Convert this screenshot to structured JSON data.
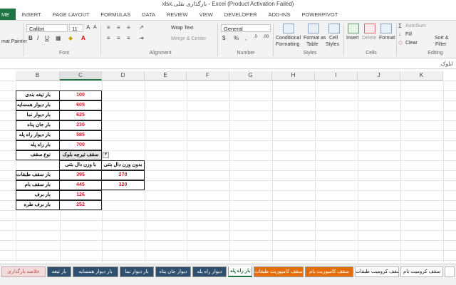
{
  "window": {
    "title": "xlsx.بارگذاری نقلی - Excel (Product Activation Failed)"
  },
  "ribbon_tabs": [
    "ME",
    "INSERT",
    "PAGE LAYOUT",
    "FORMULAS",
    "DATA",
    "REVIEW",
    "VIEW",
    "DEVELOPER",
    "ADD-INS",
    "POWERPIVOT"
  ],
  "ribbon": {
    "clipboard": {
      "format_painter": "mat Painter",
      "label": ""
    },
    "font": {
      "name": "Calibri",
      "size": "11",
      "label": "Font"
    },
    "alignment": {
      "wrap_text": "Wrap Text",
      "merge_center": "Merge & Center",
      "label": "Alignment"
    },
    "number": {
      "format": "General",
      "label": "Number"
    },
    "styles": {
      "conditional": "Conditional",
      "formatting": "Formatting",
      "format_as": "Format as",
      "table": "Table",
      "cell": "Cell",
      "styles_word": "Styles",
      "label": "Styles"
    },
    "cells": {
      "insert": "Insert",
      "delete": "Delete",
      "format": "Format",
      "label": "Cells"
    },
    "editing": {
      "autosum": "AutoSum",
      "fill": "Fill",
      "clear": "Clear",
      "sort": "Sort &",
      "filter": "Filter",
      "label": "Editing"
    }
  },
  "formula_bar": {
    "content": "ابلوک"
  },
  "columns": [
    "B",
    "C",
    "D",
    "E",
    "F",
    "G",
    "H",
    "I",
    "J",
    "K"
  ],
  "table1": [
    {
      "label": "بار تیغه بندی",
      "value": "100"
    },
    {
      "label": "بار دیوار همسایه",
      "value": "605"
    },
    {
      "label": "بار دیوار نما",
      "value": "625"
    },
    {
      "label": "بار جان پناه",
      "value": "230"
    },
    {
      "label": "بار دیوار راه پله",
      "value": "585"
    },
    {
      "label": "بار راه پله",
      "value": "700"
    }
  ],
  "roof": {
    "label": "نوع سقف",
    "selected": "سقف تیرچه بلوک"
  },
  "load_table": {
    "col_with": "با وزن دال بتنی",
    "col_without": "بدون وزن دال بتنی",
    "rows": [
      {
        "label": "بار سقف طبقات",
        "with": "395",
        "without": "270"
      },
      {
        "label": "بار سقف بام",
        "with": "445",
        "without": "320"
      },
      {
        "label": "بار برف",
        "with": "126",
        "without": ""
      },
      {
        "label": "بار برف طره",
        "with": "252",
        "without": ""
      }
    ]
  },
  "sheet_tabs": [
    {
      "label": "خلاصه بارگذاری",
      "style": "pink"
    },
    {
      "label": "بار تیغه",
      "style": "blue"
    },
    {
      "label": "بار دیوار همسایه",
      "style": "blue"
    },
    {
      "label": "بار دیوار نما",
      "style": "blue"
    },
    {
      "label": "دیوار جان پناه",
      "style": "blue"
    },
    {
      "label": "دیوار راه پله",
      "style": "blue"
    },
    {
      "label": "بار راه پله",
      "style": "active"
    },
    {
      "label": "سقف کامپوزیت طبقات",
      "style": "orange"
    },
    {
      "label": "سقف کامپوزیت بام",
      "style": "orange"
    },
    {
      "label": "سقف کرومیت طبقات",
      "style": "white"
    },
    {
      "label": "سقف کرومیت بام",
      "style": "white"
    }
  ],
  "colors": {
    "accent": "#217346",
    "value_red": "#e0112b",
    "tab_blue": "#2f4f6f",
    "tab_orange": "#e46c0a"
  }
}
